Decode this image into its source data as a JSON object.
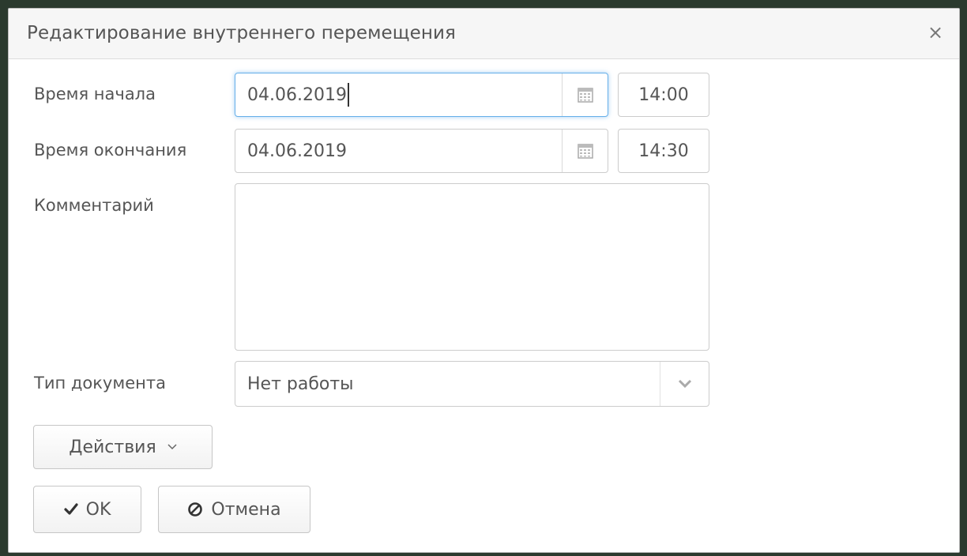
{
  "dialog": {
    "title": "Редактирование внутреннего перемещения",
    "close_label": "×"
  },
  "form": {
    "start": {
      "label": "Время начала",
      "date": "04.06.2019",
      "time": "14:00"
    },
    "end": {
      "label": "Время окончания",
      "date": "04.06.2019",
      "time": "14:30"
    },
    "comment": {
      "label": "Комментарий",
      "value": ""
    },
    "doc_type": {
      "label": "Тип документа",
      "value": "Нет работы"
    }
  },
  "actions": {
    "menu_label": "Действия",
    "ok_label": "OK",
    "cancel_label": "Отмена"
  },
  "icons": {
    "calendar": "calendar-icon",
    "chevron": "chevron-down-icon",
    "check": "check-icon",
    "cancel": "ban-icon"
  }
}
